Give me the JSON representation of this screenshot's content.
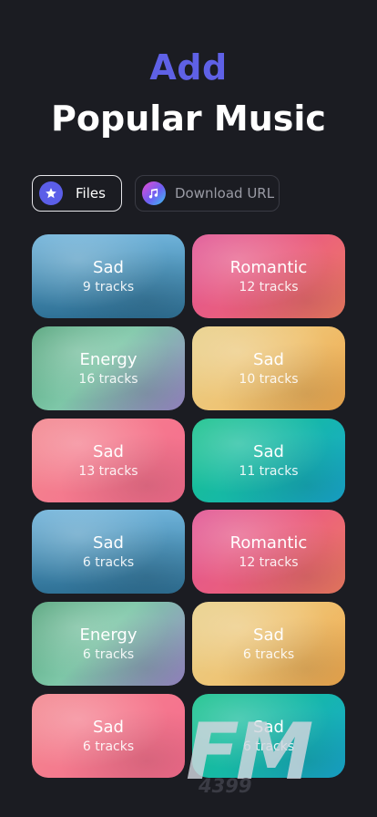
{
  "header": {
    "title_line1": "Add",
    "title_line2": "Popular Music"
  },
  "tabs": [
    {
      "label": "Files",
      "icon": "star-icon"
    },
    {
      "label": "Download URL",
      "icon": "music-note-icon"
    }
  ],
  "cards": [
    {
      "name": "Sad",
      "count": "9 tracks"
    },
    {
      "name": "Romantic",
      "count": "12 tracks"
    },
    {
      "name": "Energy",
      "count": "16 tracks"
    },
    {
      "name": "Sad",
      "count": "10 tracks"
    },
    {
      "name": "Sad",
      "count": "13 tracks"
    },
    {
      "name": "Sad",
      "count": "11 tracks"
    },
    {
      "name": "Sad",
      "count": "6 tracks"
    },
    {
      "name": "Romantic",
      "count": "12 tracks"
    },
    {
      "name": "Energy",
      "count": "6 tracks"
    },
    {
      "name": "Sad",
      "count": "6 tracks"
    },
    {
      "name": "Sad",
      "count": "6 tracks"
    },
    {
      "name": "Sad",
      "count": "6 tracks"
    }
  ],
  "watermark": {
    "logo": "FM",
    "number": "4399"
  },
  "colors": {
    "background": "#1b1c22",
    "accent": "#5f61e6"
  }
}
